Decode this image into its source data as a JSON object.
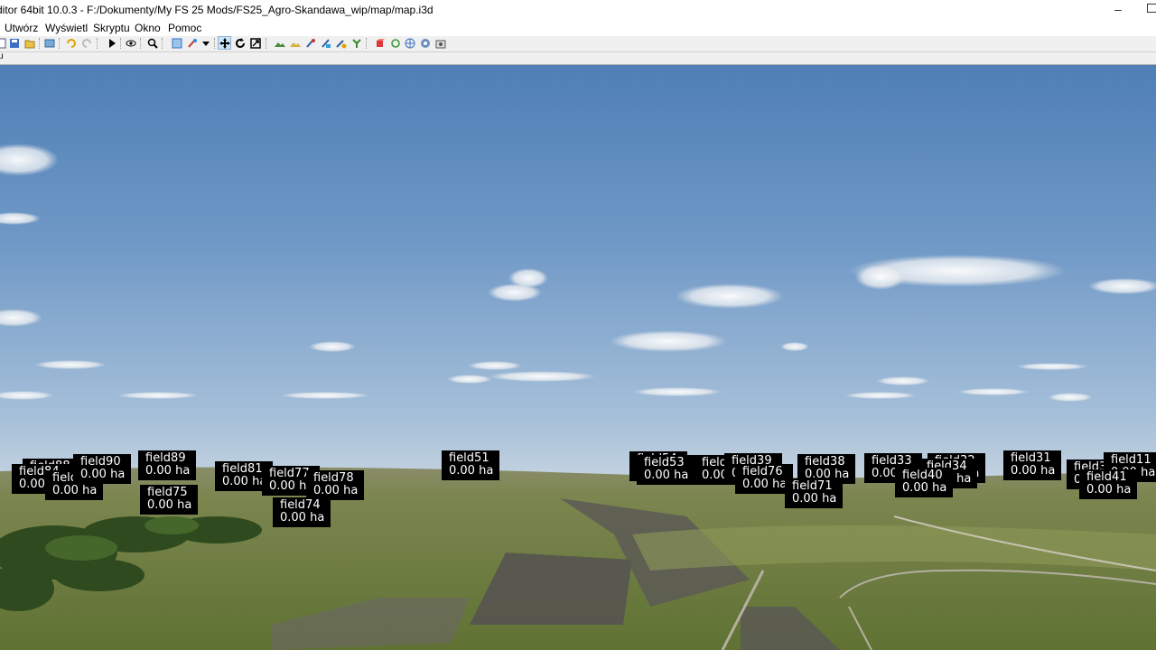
{
  "window": {
    "title": "ditor 64bit 10.0.3 - F:/Dokumenty/My FS 25 Mods/FS25_Agro-Skandawa_wip/map/map.i3d",
    "minimize_glyph": "–"
  },
  "menu": [
    "Utwórz",
    "Wyświetl",
    "Skryptu",
    "Okno",
    "Pomoc"
  ],
  "toolbar": {
    "buttons": [
      "new-file-icon",
      "save-icon",
      "open-icon",
      "refresh-icon",
      "undo-icon",
      "redo-icon",
      "play-icon",
      "eye-icon",
      "search-icon",
      "select-icon",
      "paint-icon",
      "dropdown-icon",
      "move-icon",
      "rotate-icon",
      "scale-icon",
      "terrain-sculpt-icon",
      "terrain-paint-icon",
      "foliage-paint-icon",
      "decal-icon",
      "spline-icon",
      "plant-icon",
      "cube-icon",
      "reload-icon",
      "globe-icon",
      "render-icon",
      "camera-icon"
    ]
  },
  "status": {
    "text": "u"
  },
  "colors": {
    "label_bg": "#000000",
    "label_fg": "#ffffff",
    "sky_top": "#4a7fb8",
    "grass": "#6f7d40"
  },
  "fields": [
    {
      "name": "field88",
      "area": "0.00 ha"
    },
    {
      "name": "field84",
      "area": "0.00 ha"
    },
    {
      "name": "field82",
      "area": "0.00 ha"
    },
    {
      "name": "field90",
      "area": "0.00 ha"
    },
    {
      "name": "field89",
      "area": "0.00 ha"
    },
    {
      "name": "field75",
      "area": "0.00 ha"
    },
    {
      "name": "field81",
      "area": "0.00 ha"
    },
    {
      "name": "field77",
      "area": "0.00 ha"
    },
    {
      "name": "field78",
      "area": "0.00 ha"
    },
    {
      "name": "field74",
      "area": "0.00 ha"
    },
    {
      "name": "field51",
      "area": "0.00 ha"
    },
    {
      "name": "field54",
      "area": "0.00 ha"
    },
    {
      "name": "field53",
      "area": "0.00 ha"
    },
    {
      "name": "field52",
      "area": "0.00 ha"
    },
    {
      "name": "field39",
      "area": "0.00 ha"
    },
    {
      "name": "field76",
      "area": "0.00 ha"
    },
    {
      "name": "field38",
      "area": "0.00 ha"
    },
    {
      "name": "field71",
      "area": "0.00 ha"
    },
    {
      "name": "field33",
      "area": "0.00 ha"
    },
    {
      "name": "field32",
      "area": "0.00 ha"
    },
    {
      "name": "field34",
      "area": "0.00 ha"
    },
    {
      "name": "field40",
      "area": "0.00 ha"
    },
    {
      "name": "field31",
      "area": "0.00 ha"
    },
    {
      "name": "field35",
      "area": "0.00 ha"
    },
    {
      "name": "field11",
      "area": "0.00 ha"
    },
    {
      "name": "field41",
      "area": "0.00 ha"
    }
  ]
}
